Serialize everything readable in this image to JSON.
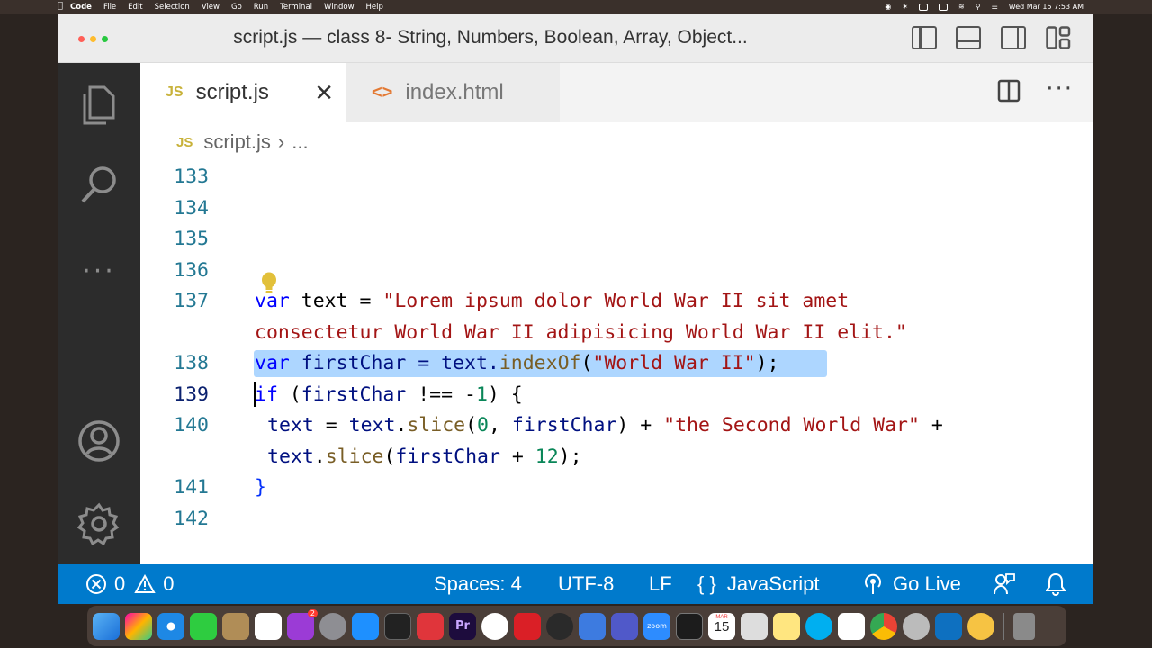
{
  "menubar": {
    "items": [
      "Code",
      "File",
      "Edit",
      "Selection",
      "View",
      "Go",
      "Run",
      "Terminal",
      "Window",
      "Help"
    ],
    "clock": "Wed Mar 15  7:53 AM"
  },
  "window": {
    "title": "script.js — class 8- String, Numbers, Boolean, Array, Object..."
  },
  "tabs": [
    {
      "label": "script.js",
      "icon": "JS",
      "active": true
    },
    {
      "label": "index.html",
      "icon": "<>",
      "active": false
    }
  ],
  "breadcrumb": {
    "icon": "JS",
    "file": "script.js",
    "rest": "..."
  },
  "editor": {
    "line_numbers": [
      "133",
      "134",
      "135",
      "136",
      "137",
      "138",
      "139",
      "140",
      "141",
      "142"
    ],
    "lines": {
      "l137a": [
        "var",
        " text = ",
        "\"Lorem ipsum dolor World War II sit amet"
      ],
      "l137b": "consectetur World War II adipisicing World War II elit.\"",
      "l138": [
        "var",
        " firstChar = text.",
        "indexOf",
        "(",
        "\"World War II\"",
        ");"
      ],
      "l139": [
        "if",
        " (",
        "firstChar",
        " !== -",
        "1",
        ") {"
      ],
      "l140a": [
        "text",
        " = ",
        "text",
        ".",
        "slice",
        "(",
        "0",
        ", ",
        "firstChar",
        ") + ",
        "\"the Second World War\"",
        " +"
      ],
      "l140b": [
        "text",
        ".",
        "slice",
        "(",
        "firstChar",
        " + ",
        "12",
        ");"
      ],
      "l141": "}"
    }
  },
  "statusbar": {
    "errors": "0",
    "warnings": "0",
    "spaces": "Spaces: 4",
    "encoding": "UTF-8",
    "eol": "LF",
    "language_icon": "{ }",
    "language": "JavaScript",
    "golive": "Go Live"
  },
  "dock": {
    "calendar_month": "MAR",
    "calendar_day": "15",
    "podcasts_badge": "2",
    "zoom_label": "zoom",
    "premiere_label": "Pr"
  },
  "colors": {
    "statusbar": "#007acc",
    "activitybar": "#2c2c2c",
    "selection": "#add6ff",
    "keyword": "#0000ff",
    "string": "#a31515",
    "number": "#098658"
  }
}
